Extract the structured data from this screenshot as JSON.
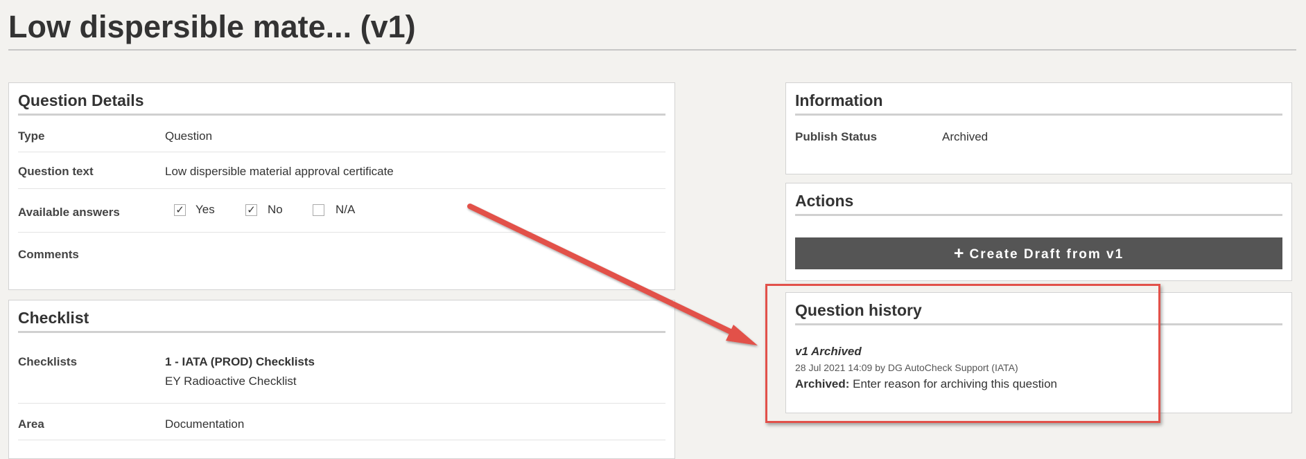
{
  "page": {
    "title": "Low dispersible mate... (v1)"
  },
  "question_details": {
    "title": "Question Details",
    "rows": {
      "type": {
        "label": "Type",
        "value": "Question"
      },
      "question_text": {
        "label": "Question text",
        "value": "Low dispersible material approval certificate"
      },
      "available_answers": {
        "label": "Available answers",
        "options": [
          {
            "label": "Yes",
            "checked": true
          },
          {
            "label": "No",
            "checked": true
          },
          {
            "label": "N/A",
            "checked": false
          }
        ]
      },
      "comments": {
        "label": "Comments",
        "value": ""
      }
    }
  },
  "checklist": {
    "title": "Checklist",
    "rows": {
      "checklists": {
        "label": "Checklists",
        "primary": "1 - IATA (PROD) Checklists",
        "secondary": "EY Radioactive Checklist"
      },
      "area": {
        "label": "Area",
        "value": "Documentation"
      }
    }
  },
  "information": {
    "title": "Information",
    "publish_status": {
      "label": "Publish Status",
      "value": "Archived"
    }
  },
  "actions": {
    "title": "Actions",
    "create_draft_label": "Create Draft from v1"
  },
  "question_history": {
    "title": "Question history",
    "entries": [
      {
        "title": "v1 Archived",
        "meta": "28 Jul 2021 14:09 by DG AutoCheck Support (IATA)",
        "reason_label": "Archived:",
        "reason_text": "Enter reason for archiving this question"
      }
    ]
  },
  "annotation": {
    "color": "#e2514a"
  },
  "icons": {
    "check": "check-icon",
    "plus": "plus-icon",
    "arrow": "arrow-annotation"
  }
}
